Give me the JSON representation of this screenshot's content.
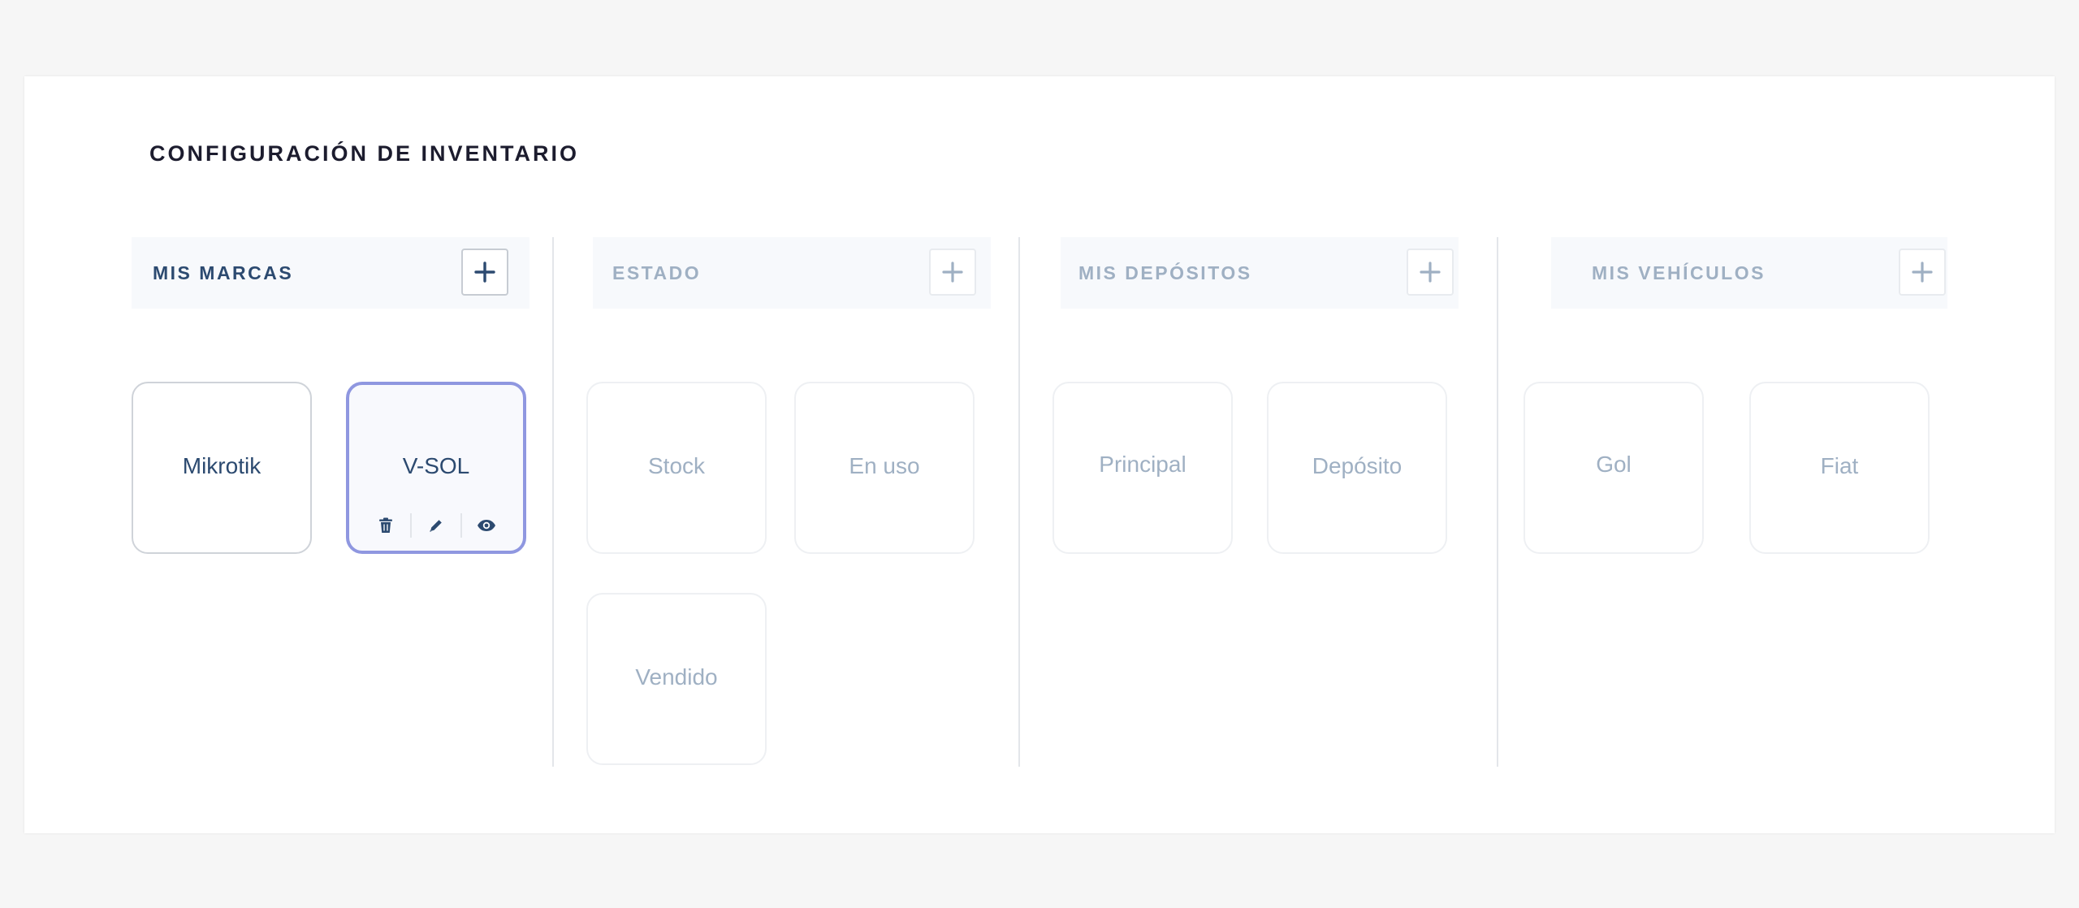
{
  "page": {
    "title": "CONFIGURACIÓN DE INVENTARIO"
  },
  "columns": [
    {
      "id": "marcas",
      "title": "MIS MARCAS",
      "add_icon": "plus-icon",
      "items": [
        "Mikrotik",
        "V-SOL"
      ],
      "selected": "V-SOL"
    },
    {
      "id": "estado",
      "title": "ESTADO",
      "add_icon": "plus-icon",
      "items": [
        "Stock",
        "En uso",
        "Vendido"
      ]
    },
    {
      "id": "depositos",
      "title": "MIS DEPÓSITOS",
      "add_icon": "plus-icon",
      "items": [
        "Principal",
        "Depósito"
      ]
    },
    {
      "id": "vehiculos",
      "title": "MIS VEHÍCULOS",
      "add_icon": "plus-icon",
      "items": [
        "Gol",
        "Fiat"
      ]
    }
  ],
  "card_actions": [
    "trash-icon",
    "pencil-icon",
    "eye-icon"
  ],
  "colors": {
    "background": "#f6f6f6",
    "selected_border": "#8f97e0",
    "active_text": "#2c4a70",
    "muted_text": "#9fb0c3",
    "title_text": "#1c1c2e"
  }
}
